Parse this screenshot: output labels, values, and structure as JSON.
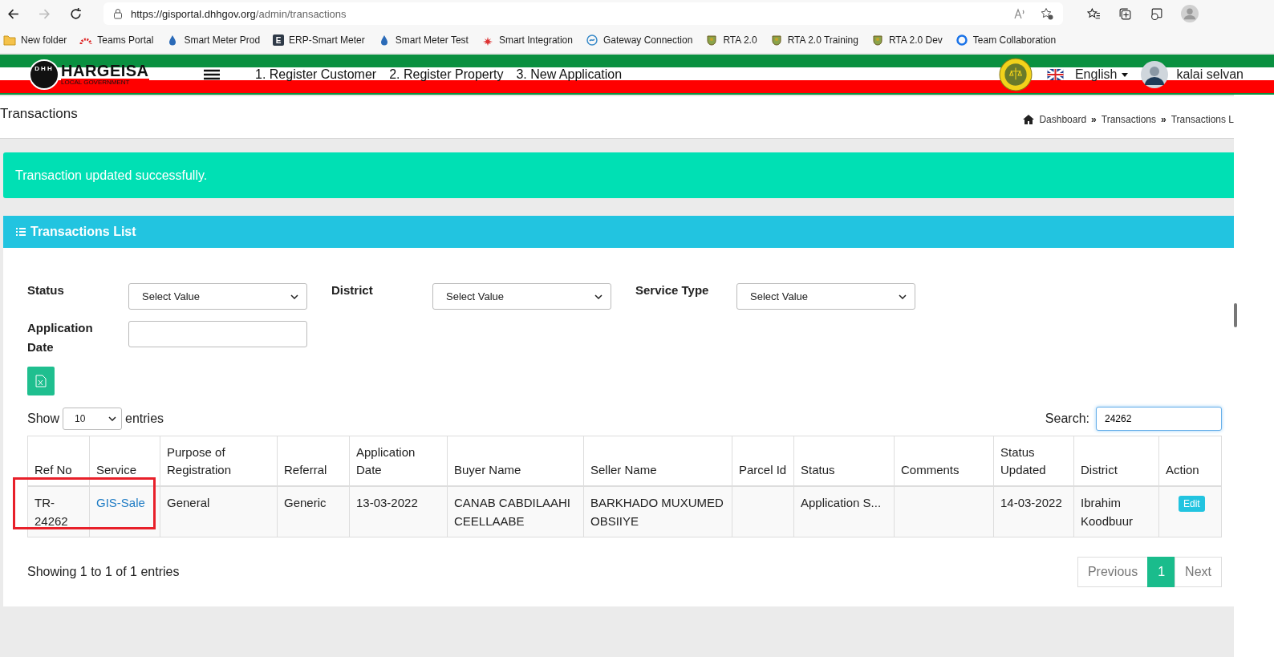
{
  "browser": {
    "url_host": "https://gisportal.dhhgov.org",
    "url_path": "/admin/transactions",
    "bookmarks": [
      {
        "label": "New folder",
        "kind": "folder"
      },
      {
        "label": "Teams Portal",
        "kind": "arc"
      },
      {
        "label": "Smart Meter Prod",
        "kind": "drop"
      },
      {
        "label": "ERP-Smart Meter",
        "kind": "letter",
        "letter": "E"
      },
      {
        "label": "Smart Meter Test",
        "kind": "drop"
      },
      {
        "label": "Smart Integration",
        "kind": "flower"
      },
      {
        "label": "Gateway Connection",
        "kind": "swirl"
      },
      {
        "label": "RTA 2.0",
        "kind": "emblem"
      },
      {
        "label": "RTA 2.0 Training",
        "kind": "emblem"
      },
      {
        "label": "RTA 2.0 Dev",
        "kind": "emblem"
      },
      {
        "label": "Team Collaboration",
        "kind": "ring"
      }
    ]
  },
  "header": {
    "logo_initials": "DHH",
    "logo_title": "HARGEISA",
    "logo_subtitle": "LOCAL GOVERNMENT",
    "nav": [
      "1. Register Customer",
      "2. Register Property",
      "3. New Application"
    ],
    "language": "English",
    "user": "kalai selvan"
  },
  "page": {
    "title": "Transactions",
    "breadcrumb": [
      "Dashboard",
      "Transactions",
      "Transactions L"
    ],
    "separator": "»"
  },
  "alert": "Transaction updated successfully.",
  "card": {
    "title": "Transactions List",
    "filters": [
      {
        "label": "Status",
        "kind": "select",
        "value": "Select Value"
      },
      {
        "label": "District",
        "kind": "select",
        "value": "Select Value"
      },
      {
        "label": "Service Type",
        "kind": "select",
        "value": "Select Value"
      },
      {
        "label": "Application Date",
        "kind": "input"
      }
    ],
    "show_label": "Show",
    "page_size": "10",
    "entries_label": "entries",
    "search_label": "Search:",
    "search_value": "24262",
    "table": {
      "columns": [
        "Ref No",
        "Service",
        "Purpose of Registration",
        "Referral",
        "Application Date",
        "Buyer Name",
        "Seller Name",
        "Parcel Id",
        "Status",
        "Comments",
        "Status Updated",
        "District",
        "Action"
      ],
      "rows": [
        {
          "cells": [
            {
              "kind": "text",
              "text": "TR-24262"
            },
            {
              "kind": "link",
              "text": "GIS-Sale"
            },
            {
              "kind": "text",
              "text": "General"
            },
            {
              "kind": "text",
              "text": "Generic"
            },
            {
              "kind": "text",
              "text": "13-03-2022"
            },
            {
              "kind": "text",
              "text": "CANAB CABDILAAHI CEELLAABE"
            },
            {
              "kind": "text",
              "text": "BARKHADO MUXUMED OBSIIYE"
            },
            {
              "kind": "empty"
            },
            {
              "kind": "text",
              "text": "Application S..."
            },
            {
              "kind": "empty"
            },
            {
              "kind": "text",
              "text": "14-03-2022"
            },
            {
              "kind": "text",
              "text": "Ibrahim Koodbuur"
            },
            {
              "kind": "button",
              "text": "Edit"
            }
          ]
        }
      ]
    },
    "info": "Showing 1 to 1 of 1 entries",
    "pagination": [
      {
        "label": "Previous",
        "selected": false
      },
      {
        "label": "1",
        "selected": true
      },
      {
        "label": "Next",
        "selected": false
      }
    ]
  }
}
